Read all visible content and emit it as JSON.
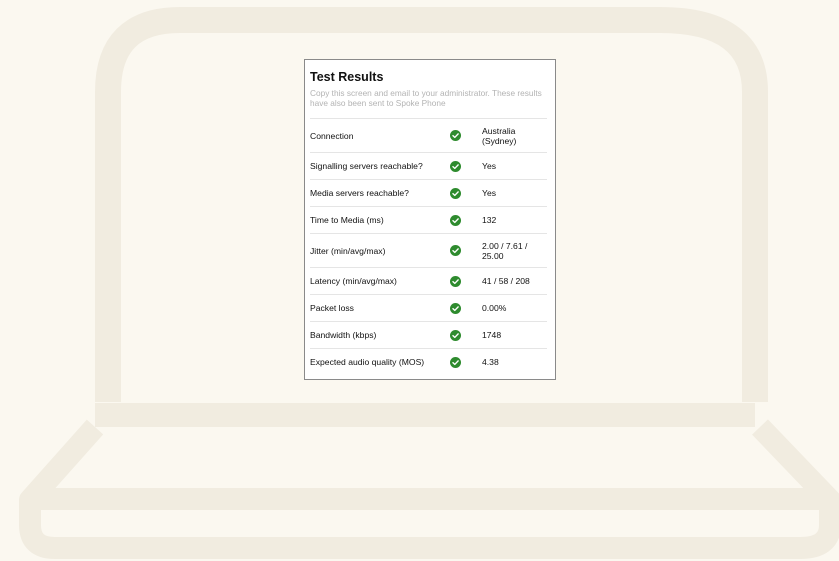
{
  "colors": {
    "background": "#fbf8f0",
    "laptop_outline": "#f1ece0",
    "success": "#2e8b2e"
  },
  "card": {
    "title": "Test Results",
    "subtitle": "Copy this screen and email to your administrator. These results have also been sent to Spoke Phone"
  },
  "results": [
    {
      "label": "Connection",
      "status_icon": "check-circle-icon",
      "value": "Australia (Sydney)"
    },
    {
      "label": "Signalling servers reachable?",
      "status_icon": "check-circle-icon",
      "value": "Yes"
    },
    {
      "label": "Media servers reachable?",
      "status_icon": "check-circle-icon",
      "value": "Yes"
    },
    {
      "label": "Time to Media (ms)",
      "status_icon": "check-circle-icon",
      "value": "132"
    },
    {
      "label": "Jitter (min/avg/max)",
      "status_icon": "check-circle-icon",
      "value": "2.00 / 7.61 / 25.00"
    },
    {
      "label": "Latency (min/avg/max)",
      "status_icon": "check-circle-icon",
      "value": "41 / 58 / 208"
    },
    {
      "label": "Packet loss",
      "status_icon": "check-circle-icon",
      "value": "0.00%"
    },
    {
      "label": "Bandwidth (kbps)",
      "status_icon": "check-circle-icon",
      "value": "1748"
    },
    {
      "label": "Expected audio quality (MOS)",
      "status_icon": "check-circle-icon",
      "value": "4.38"
    }
  ]
}
